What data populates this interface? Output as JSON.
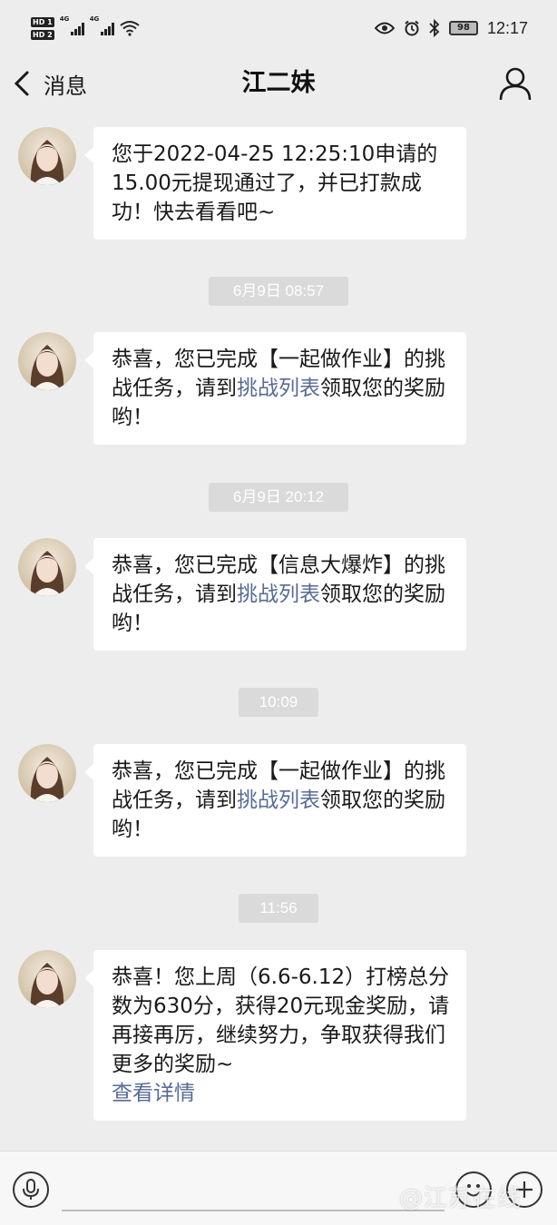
{
  "status_bar": {
    "hd1": "HD 1",
    "hd2": "HD 2",
    "net1": "4G",
    "net2": "4G",
    "battery": "98",
    "time": "12:17"
  },
  "nav": {
    "back_label": "消息",
    "title": "江二妹"
  },
  "messages": [
    {
      "type": "text",
      "parts": [
        "您于2022-04-25 12:25:10申请的15.00元提现通过了，并已打款成功！快去看看吧~"
      ]
    },
    {
      "type": "time",
      "text": "6月9日 08:57"
    },
    {
      "type": "text",
      "before": "恭喜，您已完成【一起做作业】的挑战任务，请到",
      "link": "挑战列表",
      "after": "领取您的奖励哟！"
    },
    {
      "type": "time",
      "text": "6月9日 20:12"
    },
    {
      "type": "text",
      "before": "恭喜，您已完成【信息大爆炸】的挑战任务，请到",
      "link": "挑战列表",
      "after": "领取您的奖励哟！"
    },
    {
      "type": "time",
      "text": "10:09"
    },
    {
      "type": "text",
      "before": "恭喜，您已完成【一起做作业】的挑战任务，请到",
      "link": "挑战列表",
      "after": "领取您的奖励哟！"
    },
    {
      "type": "time",
      "text": "11:56"
    },
    {
      "type": "text",
      "body": "恭喜！您上周（6.6-6.12）打榜总分数为630分，获得20元现金奖励，请再接再厉，继续努力，争取获得我们更多的奖励~",
      "detail": "查看详情"
    }
  ],
  "input": {
    "placeholder": ""
  },
  "watermark": "@江苏在线",
  "colors": {
    "background": "#ededed",
    "bubble": "#ffffff",
    "link": "#576b95",
    "time_chip": "#dadada"
  },
  "icons": [
    "back-arrow-icon",
    "person-icon",
    "voice-icon",
    "emoji-icon",
    "plus-icon",
    "eye-icon",
    "alarm-icon",
    "bluetooth-icon",
    "wifi-icon"
  ]
}
